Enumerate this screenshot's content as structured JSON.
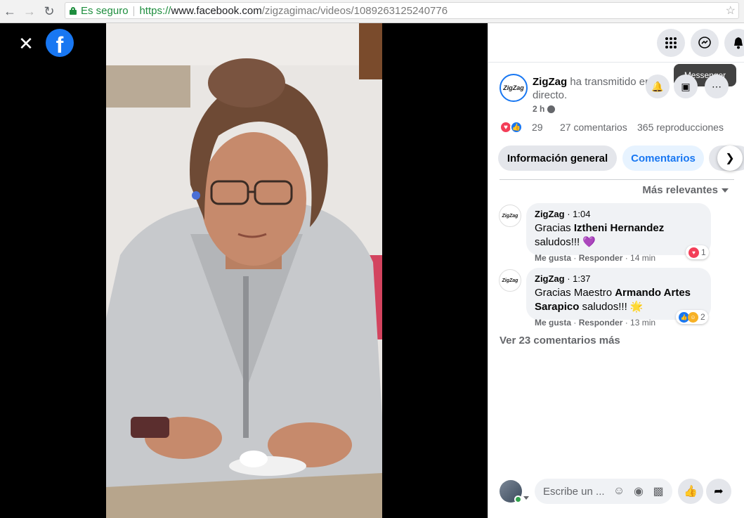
{
  "browser": {
    "secure_label": "Es seguro",
    "url_scheme": "https://",
    "url_host": "www.facebook.com",
    "url_path": "/zigzagimac/videos/1089263125240776"
  },
  "video": {
    "close_icon": "close-icon",
    "logo": "f"
  },
  "top_icons": {
    "menu_icon": "grid-menu-icon",
    "messenger_icon": "messenger-icon",
    "notifications_icon": "bell-icon",
    "tooltip": "Messenger"
  },
  "post": {
    "avatar_text": "ZigZag",
    "author": "ZigZag",
    "action": "ha transmitido en directo.",
    "time": "2 h",
    "reaction_count": "29",
    "comments": "27 comentarios",
    "views": "365 reproducciones"
  },
  "tabs": {
    "general": "Información general",
    "comments": "Comentarios"
  },
  "sort": {
    "label": "Más relevantes"
  },
  "comments": [
    {
      "author": "ZigZag",
      "time": "1:04",
      "pre": "Gracias ",
      "bold": "Iztheni Hernandez",
      "post": "saludos!!! 💜",
      "like": "Me gusta",
      "reply": "Responder",
      "ago": "14 min",
      "reaction_count": "1"
    },
    {
      "author": "ZigZag",
      "time": "1:37",
      "pre": "Gracias Maestro ",
      "bold": "Armando Artes Sarapico",
      "post": " saludos!!! 🌟",
      "like": "Me gusta",
      "reply": "Responder",
      "ago": "13 min",
      "reaction_count": "2"
    }
  ],
  "more_comments": "Ver 23 comentarios más",
  "compose": {
    "placeholder": "Escribe un ..."
  },
  "colors": {
    "brand": "#1877f2",
    "secure": "#1e8e3e",
    "love": "#f33e58"
  }
}
